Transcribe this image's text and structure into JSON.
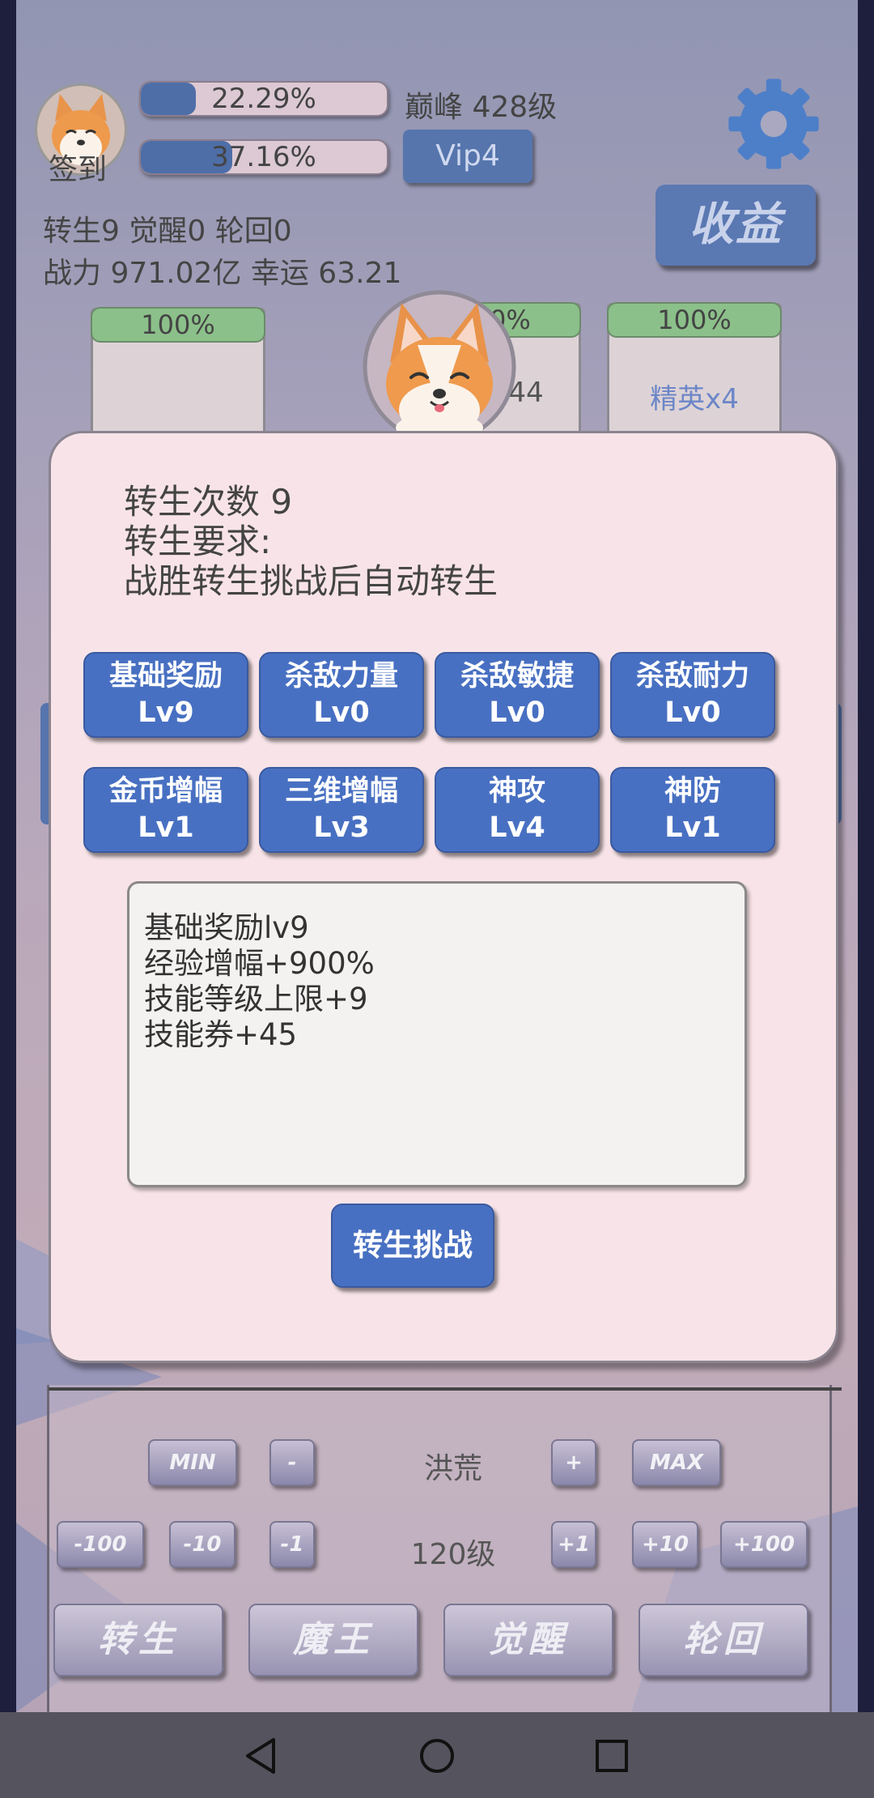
{
  "header": {
    "checkin_label": "签到",
    "exp_bar_1": {
      "label": "22.29%",
      "value": 0.2229
    },
    "exp_bar_2": {
      "label": "37.16%",
      "value": 0.3716
    },
    "peak_level": "巅峰 428级",
    "vip_label": "Vip4",
    "income_label": "收益",
    "stats_line_1": "转生9 觉醒0 轮回0",
    "stats_line_2": "战力 971.02亿  幸运 63.21"
  },
  "cards": [
    {
      "hp_label": "100%",
      "name": ""
    },
    {
      "hp_label": "100%",
      "name": "x44"
    },
    {
      "hp_label": "100%",
      "name": "精英x4"
    }
  ],
  "modal": {
    "info_line_1": "转生次数 9",
    "info_line_2": "转生要求:",
    "info_line_3": "战胜转生挑战后自动转生",
    "skills": [
      {
        "name": "基础奖励",
        "level": "Lv9"
      },
      {
        "name": "杀敌力量",
        "level": "Lv0"
      },
      {
        "name": "杀敌敏捷",
        "level": "Lv0"
      },
      {
        "name": "杀敌耐力",
        "level": "Lv0"
      },
      {
        "name": "金币增幅",
        "level": "Lv1"
      },
      {
        "name": "三维增幅",
        "level": "Lv3"
      },
      {
        "name": "神攻",
        "level": "Lv4"
      },
      {
        "name": "神防",
        "level": "Lv1"
      }
    ],
    "description": [
      "基础奖励lv9",
      "经验增幅+900%",
      "技能等级上限+9",
      "技能券+45"
    ],
    "challenge_label": "转生挑战"
  },
  "controls": {
    "min_label": "MIN",
    "minus_label": "-",
    "area_name": "洪荒",
    "plus_label": "+",
    "max_label": "MAX",
    "minus100_label": "-100",
    "minus10_label": "-10",
    "minus1_label": "-1",
    "level_label": "120级",
    "plus1_label": "+1",
    "plus10_label": "+10",
    "plus100_label": "+100"
  },
  "tabs": [
    "转生",
    "魔王",
    "觉醒",
    "轮回"
  ],
  "colors": {
    "primary_button": "#4870c2",
    "modal_bg": "#f8e4e8",
    "hp_bar": "#8cc08a",
    "progress_fill": "#4e6ea8"
  }
}
